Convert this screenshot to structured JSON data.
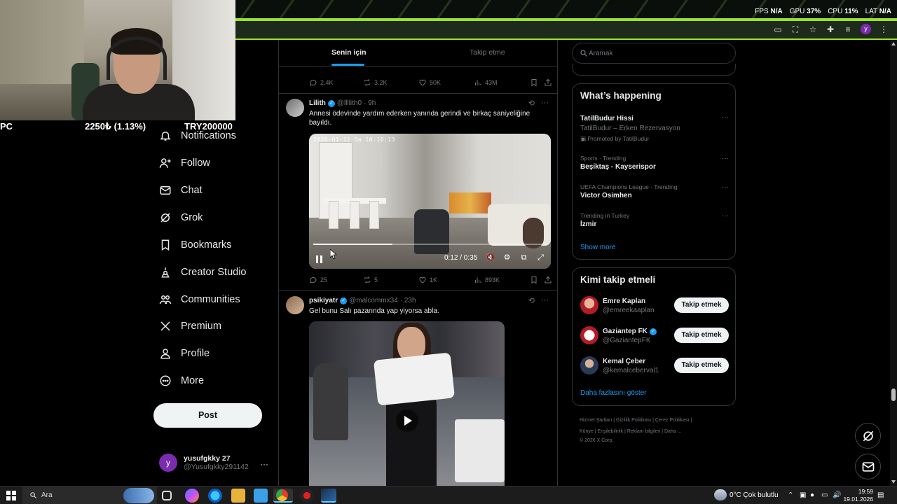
{
  "overlay": {
    "perf": {
      "fps_label": "FPS",
      "fps_value": "N/A",
      "gpu_label": "GPU",
      "gpu_value": "37%",
      "cpu_label": "CPU",
      "cpu_value": "11%",
      "lat_label": "LAT",
      "lat_value": "N/A"
    },
    "ticker": {
      "left": "PC",
      "price": "2250₺ (1.13%)",
      "goal": "TRY200000"
    }
  },
  "nav": {
    "items": [
      {
        "label": "Notifications",
        "icon": "bell-icon"
      },
      {
        "label": "Follow",
        "icon": "person-add-icon"
      },
      {
        "label": "Chat",
        "icon": "mail-icon"
      },
      {
        "label": "Grok",
        "icon": "grok-icon"
      },
      {
        "label": "Bookmarks",
        "icon": "bookmark-icon"
      },
      {
        "label": "Creator Studio",
        "icon": "creator-icon"
      },
      {
        "label": "Communities",
        "icon": "communities-icon"
      },
      {
        "label": "Premium",
        "icon": "x-logo-icon"
      },
      {
        "label": "Profile",
        "icon": "person-icon"
      },
      {
        "label": "More",
        "icon": "more-circle-icon"
      }
    ],
    "post_label": "Post",
    "account": {
      "avatar_letter": "y",
      "name": "yusufgkky 27",
      "handle": "@Yusufgkky291142",
      "more": "···"
    }
  },
  "feed": {
    "tabs": {
      "active": "Senin için",
      "inactive": "Takip etme"
    },
    "prev_actions": {
      "replies": "2.4K",
      "reposts": "3.2K",
      "likes": "50K",
      "views": "43M"
    },
    "tweets": [
      {
        "name": "Lilith",
        "handle": "@llllith0",
        "time": "· 9h",
        "text": "Annesi ödevinde yardım ederken yanında gerindi ve birkaç saniyeliğine bayıldı.",
        "video": {
          "timestamp": "2026-01-12 Sa 10:16:13",
          "time_label": "0:12 / 0:35",
          "progress": 0.34
        },
        "actions": {
          "replies": "25",
          "reposts": "5",
          "likes": "1K",
          "views": "893K"
        }
      },
      {
        "name": "psikiyatr",
        "handle": "@malcommx34",
        "time": "· 23h",
        "text": "Gel bunu Salı pazarında yap yiyorsa abla."
      }
    ]
  },
  "sidebar": {
    "search_placeholder": "Aramak",
    "happening_title": "What’s happening",
    "trends": [
      {
        "meta": "",
        "name": "TatilBudur Hissi",
        "sub": "TatilBudur – Erken Rezervasyon",
        "promo": "Promoted by TatilBudur"
      },
      {
        "meta": "Sports · Trending",
        "name": "Beşiktaş - Kayserispor"
      },
      {
        "meta": "UEFA Champions League · Trending",
        "name": "Victor Osimhen"
      },
      {
        "meta": "Trending in Turkey",
        "name": "İzmir"
      }
    ],
    "show_more": "Show more",
    "who_title": "Kimi takip etmeli",
    "who": [
      {
        "name": "Emre Kaplan",
        "handle": "@emreekaaplan",
        "verified": false,
        "btn": "Takip etmek"
      },
      {
        "name": "Gaziantep FK",
        "handle": "@GaziantepFK",
        "verified": true,
        "btn": "Takip etmek"
      },
      {
        "name": "Kemal Çeber",
        "handle": "@kemalceberval1",
        "verified": false,
        "btn": "Takip etmek"
      }
    ],
    "who_more": "Daha fazlasını göster",
    "footer": {
      "line1": "Hizmet Şartları  |  Gizlilik Politikası  |  Çerez Politikası  |",
      "line2": "Künye  |  Erişilebilirlik  |  Reklam bilgileri  |  Daha ...",
      "line3": "© 2026 X Corp."
    }
  },
  "taskbar": {
    "search_text": "Ara",
    "weather": "0°C  Çok bulutlu",
    "time": "19:59",
    "date": "19.01.2026"
  },
  "colors": {
    "accent": "#1d9bf0",
    "banner": "#9be22d",
    "background": "#000000"
  }
}
